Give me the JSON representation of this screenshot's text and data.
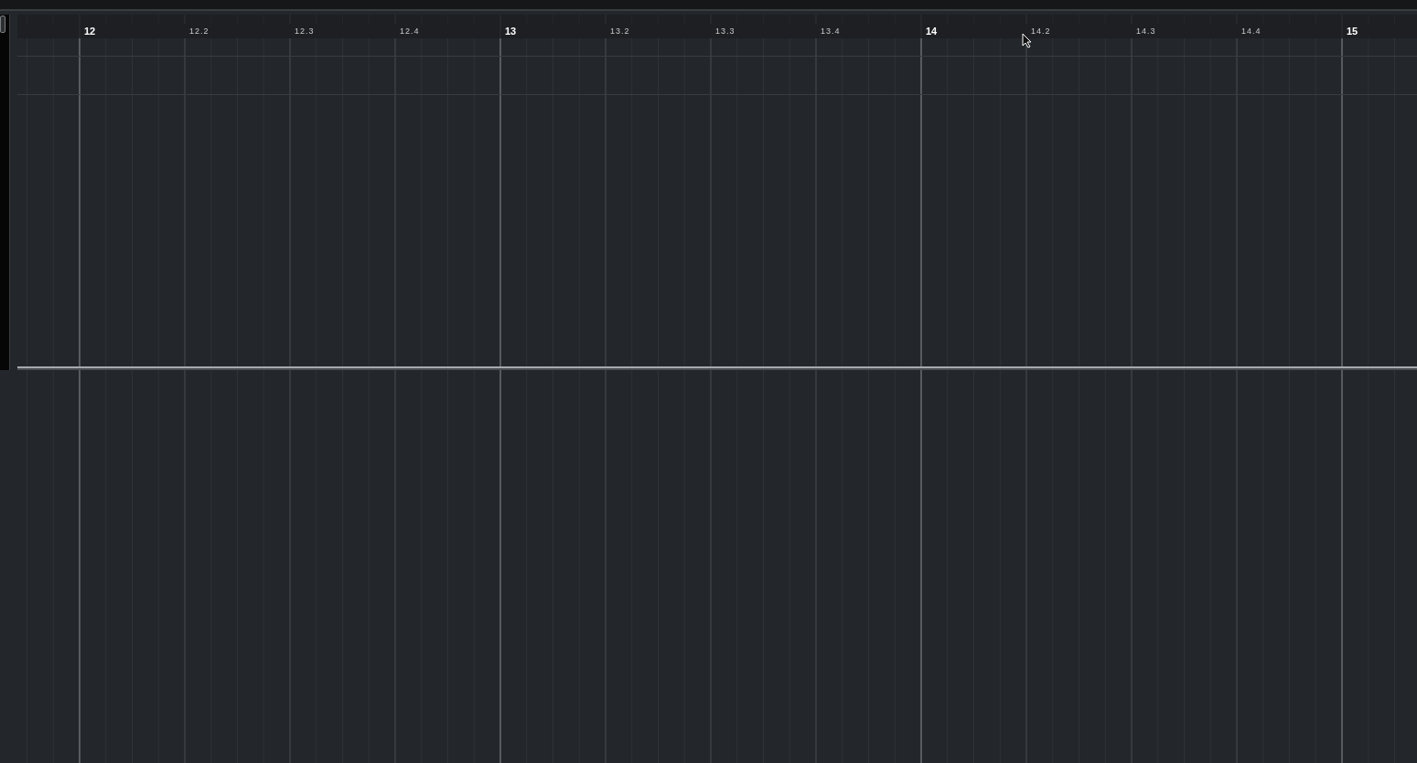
{
  "ruler": {
    "labels": [
      {
        "text": "12",
        "kind": "bar"
      },
      {
        "text": "12.2",
        "kind": "beat"
      },
      {
        "text": "12.3",
        "kind": "beat"
      },
      {
        "text": "12.4",
        "kind": "beat"
      },
      {
        "text": "13",
        "kind": "bar"
      },
      {
        "text": "13.2",
        "kind": "beat"
      },
      {
        "text": "13.3",
        "kind": "beat"
      },
      {
        "text": "13.4",
        "kind": "beat"
      },
      {
        "text": "14",
        "kind": "bar"
      },
      {
        "text": "14.2",
        "kind": "beat"
      },
      {
        "text": "14.3",
        "kind": "beat"
      },
      {
        "text": "14.4",
        "kind": "beat"
      },
      {
        "text": "15",
        "kind": "bar"
      }
    ]
  }
}
